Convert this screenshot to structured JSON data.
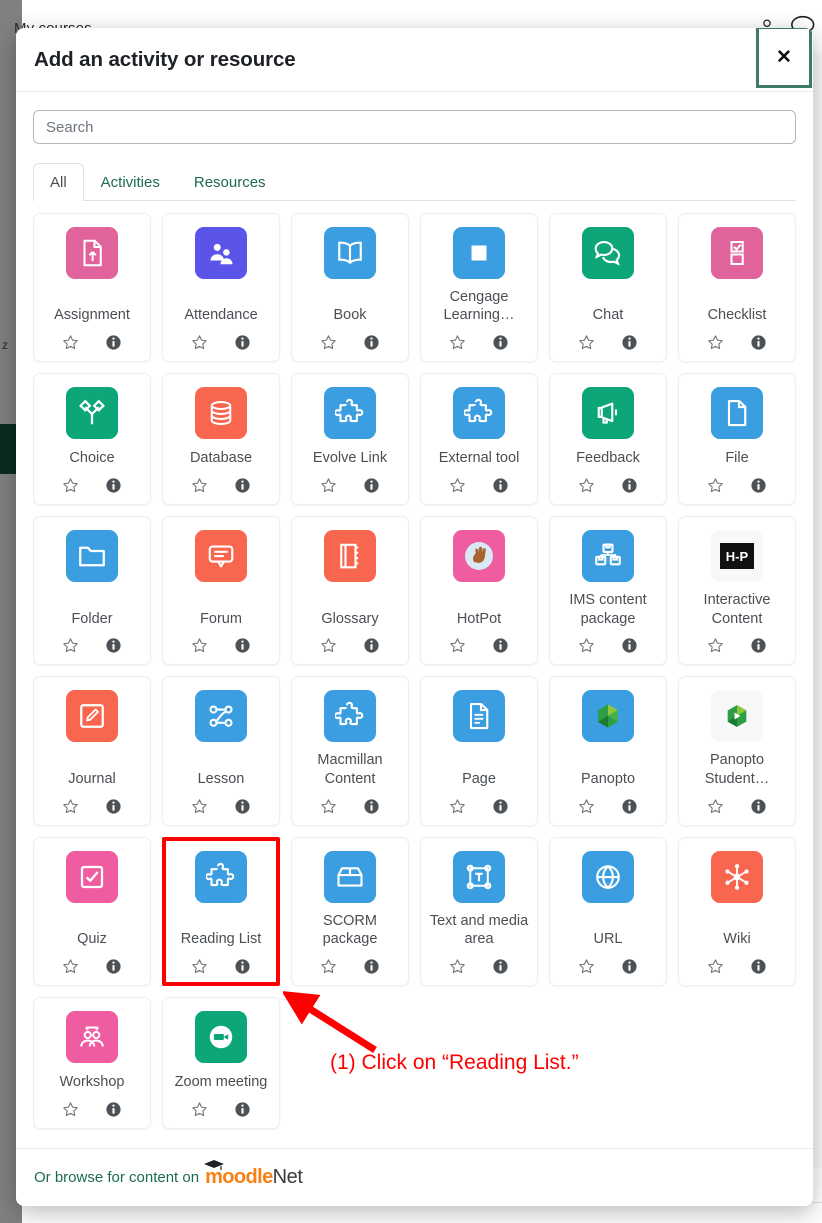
{
  "background": {
    "breadcrumb": "My courses",
    "stray_letter": "z",
    "icons": [
      "user-icon",
      "chat-icon"
    ]
  },
  "modal": {
    "title": "Add an activity or resource",
    "close_label": "✕",
    "close_icon": "close-icon",
    "border_accent": "#3d7a67"
  },
  "search": {
    "placeholder": "Search",
    "value": ""
  },
  "tabs": [
    {
      "label": "All",
      "active": true
    },
    {
      "label": "Activities",
      "active": false
    },
    {
      "label": "Resources",
      "active": false
    }
  ],
  "footer": {
    "text": "Or browse for content on",
    "brand_part1": "moodle",
    "brand_part2": "Net",
    "brand_color_1": "#f98012",
    "brand_color_2": "#3b3b3b"
  },
  "annotation": {
    "text": "(1) Click on “Reading List.”",
    "color": "#fe0000",
    "arrow": "arrow-up-left-icon"
  },
  "card_actions": {
    "star_icon": "star-outline-icon",
    "info_icon": "info-circle-icon"
  },
  "items": [
    {
      "label": "Assignment",
      "icon": "assignment-icon",
      "color": "#e0649b",
      "glyph": "file-up"
    },
    {
      "label": "Attendance",
      "icon": "attendance-icon",
      "color": "#5a55e8",
      "glyph": "people"
    },
    {
      "label": "Book",
      "icon": "book-icon",
      "color": "#3a9ee0",
      "glyph": "book"
    },
    {
      "label": "Cengage Learning…",
      "icon": "cengage-learning-icon",
      "color": "#3a9ee0",
      "glyph": "square"
    },
    {
      "label": "Chat",
      "icon": "chat-icon",
      "color": "#0ca678",
      "glyph": "bubbles"
    },
    {
      "label": "Checklist",
      "icon": "checklist-icon",
      "color": "#e0649b",
      "glyph": "checklist"
    },
    {
      "label": "Choice",
      "icon": "choice-icon",
      "color": "#0ca678",
      "glyph": "fork"
    },
    {
      "label": "Database",
      "icon": "database-icon",
      "color": "#f8664f",
      "glyph": "database"
    },
    {
      "label": "Evolve Link",
      "icon": "evolve-link-icon",
      "color": "#3a9ee0",
      "glyph": "puzzle"
    },
    {
      "label": "External tool",
      "icon": "external-tool-icon",
      "color": "#3a9ee0",
      "glyph": "puzzle"
    },
    {
      "label": "Feedback",
      "icon": "feedback-icon",
      "color": "#0ca678",
      "glyph": "megaphone"
    },
    {
      "label": "File",
      "icon": "file-icon",
      "color": "#3a9ee0",
      "glyph": "file"
    },
    {
      "label": "Folder",
      "icon": "folder-icon",
      "color": "#3a9ee0",
      "glyph": "folder"
    },
    {
      "label": "Forum",
      "icon": "forum-icon",
      "color": "#f8664f",
      "glyph": "comment"
    },
    {
      "label": "Glossary",
      "icon": "glossary-icon",
      "color": "#f8664f",
      "glyph": "notebook"
    },
    {
      "label": "HotPot",
      "icon": "hotpot-icon",
      "color": "#ef5ca0",
      "glyph": "hand"
    },
    {
      "label": "IMS content package",
      "icon": "ims-content-package-icon",
      "color": "#3a9ee0",
      "glyph": "boxes"
    },
    {
      "label": "Interactive Content",
      "icon": "interactive-content-icon",
      "color": "#f7f8f9",
      "glyph": "h5p"
    },
    {
      "label": "Journal",
      "icon": "journal-icon",
      "color": "#f8664f",
      "glyph": "pencil-square"
    },
    {
      "label": "Lesson",
      "icon": "lesson-icon",
      "color": "#3a9ee0",
      "glyph": "flow"
    },
    {
      "label": "Macmillan Content",
      "icon": "macmillan-content-icon",
      "color": "#3a9ee0",
      "glyph": "puzzle"
    },
    {
      "label": "Page",
      "icon": "page-icon",
      "color": "#3a9ee0",
      "glyph": "page"
    },
    {
      "label": "Panopto",
      "icon": "panopto-icon",
      "color": "#3a9ee0",
      "glyph": "panopto"
    },
    {
      "label": "Panopto Student…",
      "icon": "panopto-student-icon",
      "color": "#f7f8f9",
      "glyph": "panopto-plain"
    },
    {
      "label": "Quiz",
      "icon": "quiz-icon",
      "color": "#ef5ca0",
      "glyph": "check-square"
    },
    {
      "label": "Reading List",
      "icon": "reading-list-icon",
      "color": "#3a9ee0",
      "glyph": "puzzle",
      "highlighted": true
    },
    {
      "label": "SCORM package",
      "icon": "scorm-package-icon",
      "color": "#3a9ee0",
      "glyph": "package"
    },
    {
      "label": "Text and media area",
      "icon": "text-and-media-area-icon",
      "color": "#3a9ee0",
      "glyph": "text-box"
    },
    {
      "label": "URL",
      "icon": "url-icon",
      "color": "#3a9ee0",
      "glyph": "globe"
    },
    {
      "label": "Wiki",
      "icon": "wiki-icon",
      "color": "#f8664f",
      "glyph": "network"
    },
    {
      "label": "Workshop",
      "icon": "workshop-icon",
      "color": "#ef5ca0",
      "glyph": "workshop"
    },
    {
      "label": "Zoom meeting",
      "icon": "zoom-meeting-icon",
      "color": "#0ca678",
      "glyph": "video"
    }
  ]
}
